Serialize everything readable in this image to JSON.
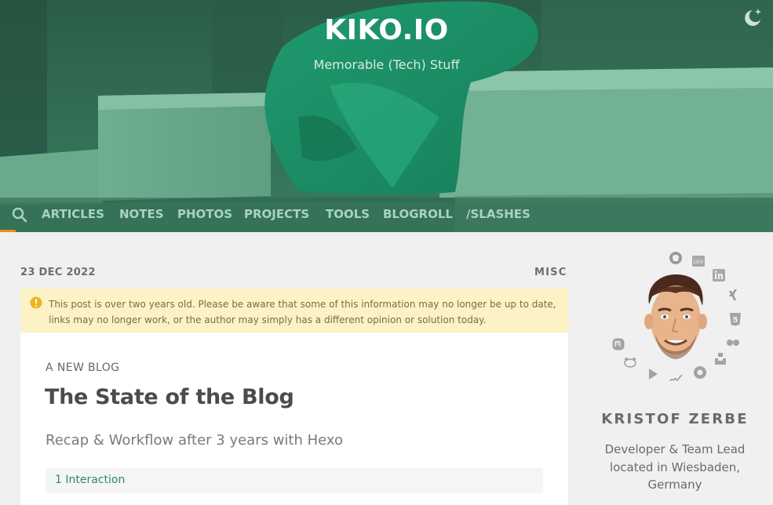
{
  "header": {
    "site_title": "KIKO.IO",
    "site_subtitle": "Memorable (Tech) Stuff",
    "theme_toggle_icon": "moon-stars-icon",
    "accent_color": "#f28c18"
  },
  "nav": {
    "search_icon": "search-icon",
    "items": [
      {
        "label": "ARTICLES"
      },
      {
        "label": "NOTES"
      },
      {
        "label": "PHOTOS"
      },
      {
        "label": "PROJECTS"
      },
      {
        "label": "TOOLS"
      },
      {
        "label": "BLOGROLL"
      },
      {
        "label": "/SLASHES"
      }
    ]
  },
  "post": {
    "date": "23 DEC 2022",
    "category": "MISC",
    "warning": "This post is over two years old. Please be aware that some of this information may no longer be up to date, links may no longer work, or the author may simply has a different opinion or solution today.",
    "kicker": "A NEW BLOG",
    "title": "The State of the Blog",
    "subtitle": "Recap & Workflow after 3 years with Hexo",
    "interactions": "1 Interaction"
  },
  "sidebar": {
    "author_name": "KRISTOF ZERBE",
    "bio_line1": "Developer & Team Lead",
    "bio_line2": "located in Wiesbaden,",
    "bio_line3": "Germany",
    "social_icons": [
      "github-icon",
      "dev-icon",
      "linkedin-icon",
      "xing-icon",
      "html5-icon",
      "flickr-icon",
      "unsplash-icon",
      "mastodon-icon",
      "pixelfed-icon",
      "play-icon",
      "signature-icon",
      "podcast-icon"
    ]
  }
}
